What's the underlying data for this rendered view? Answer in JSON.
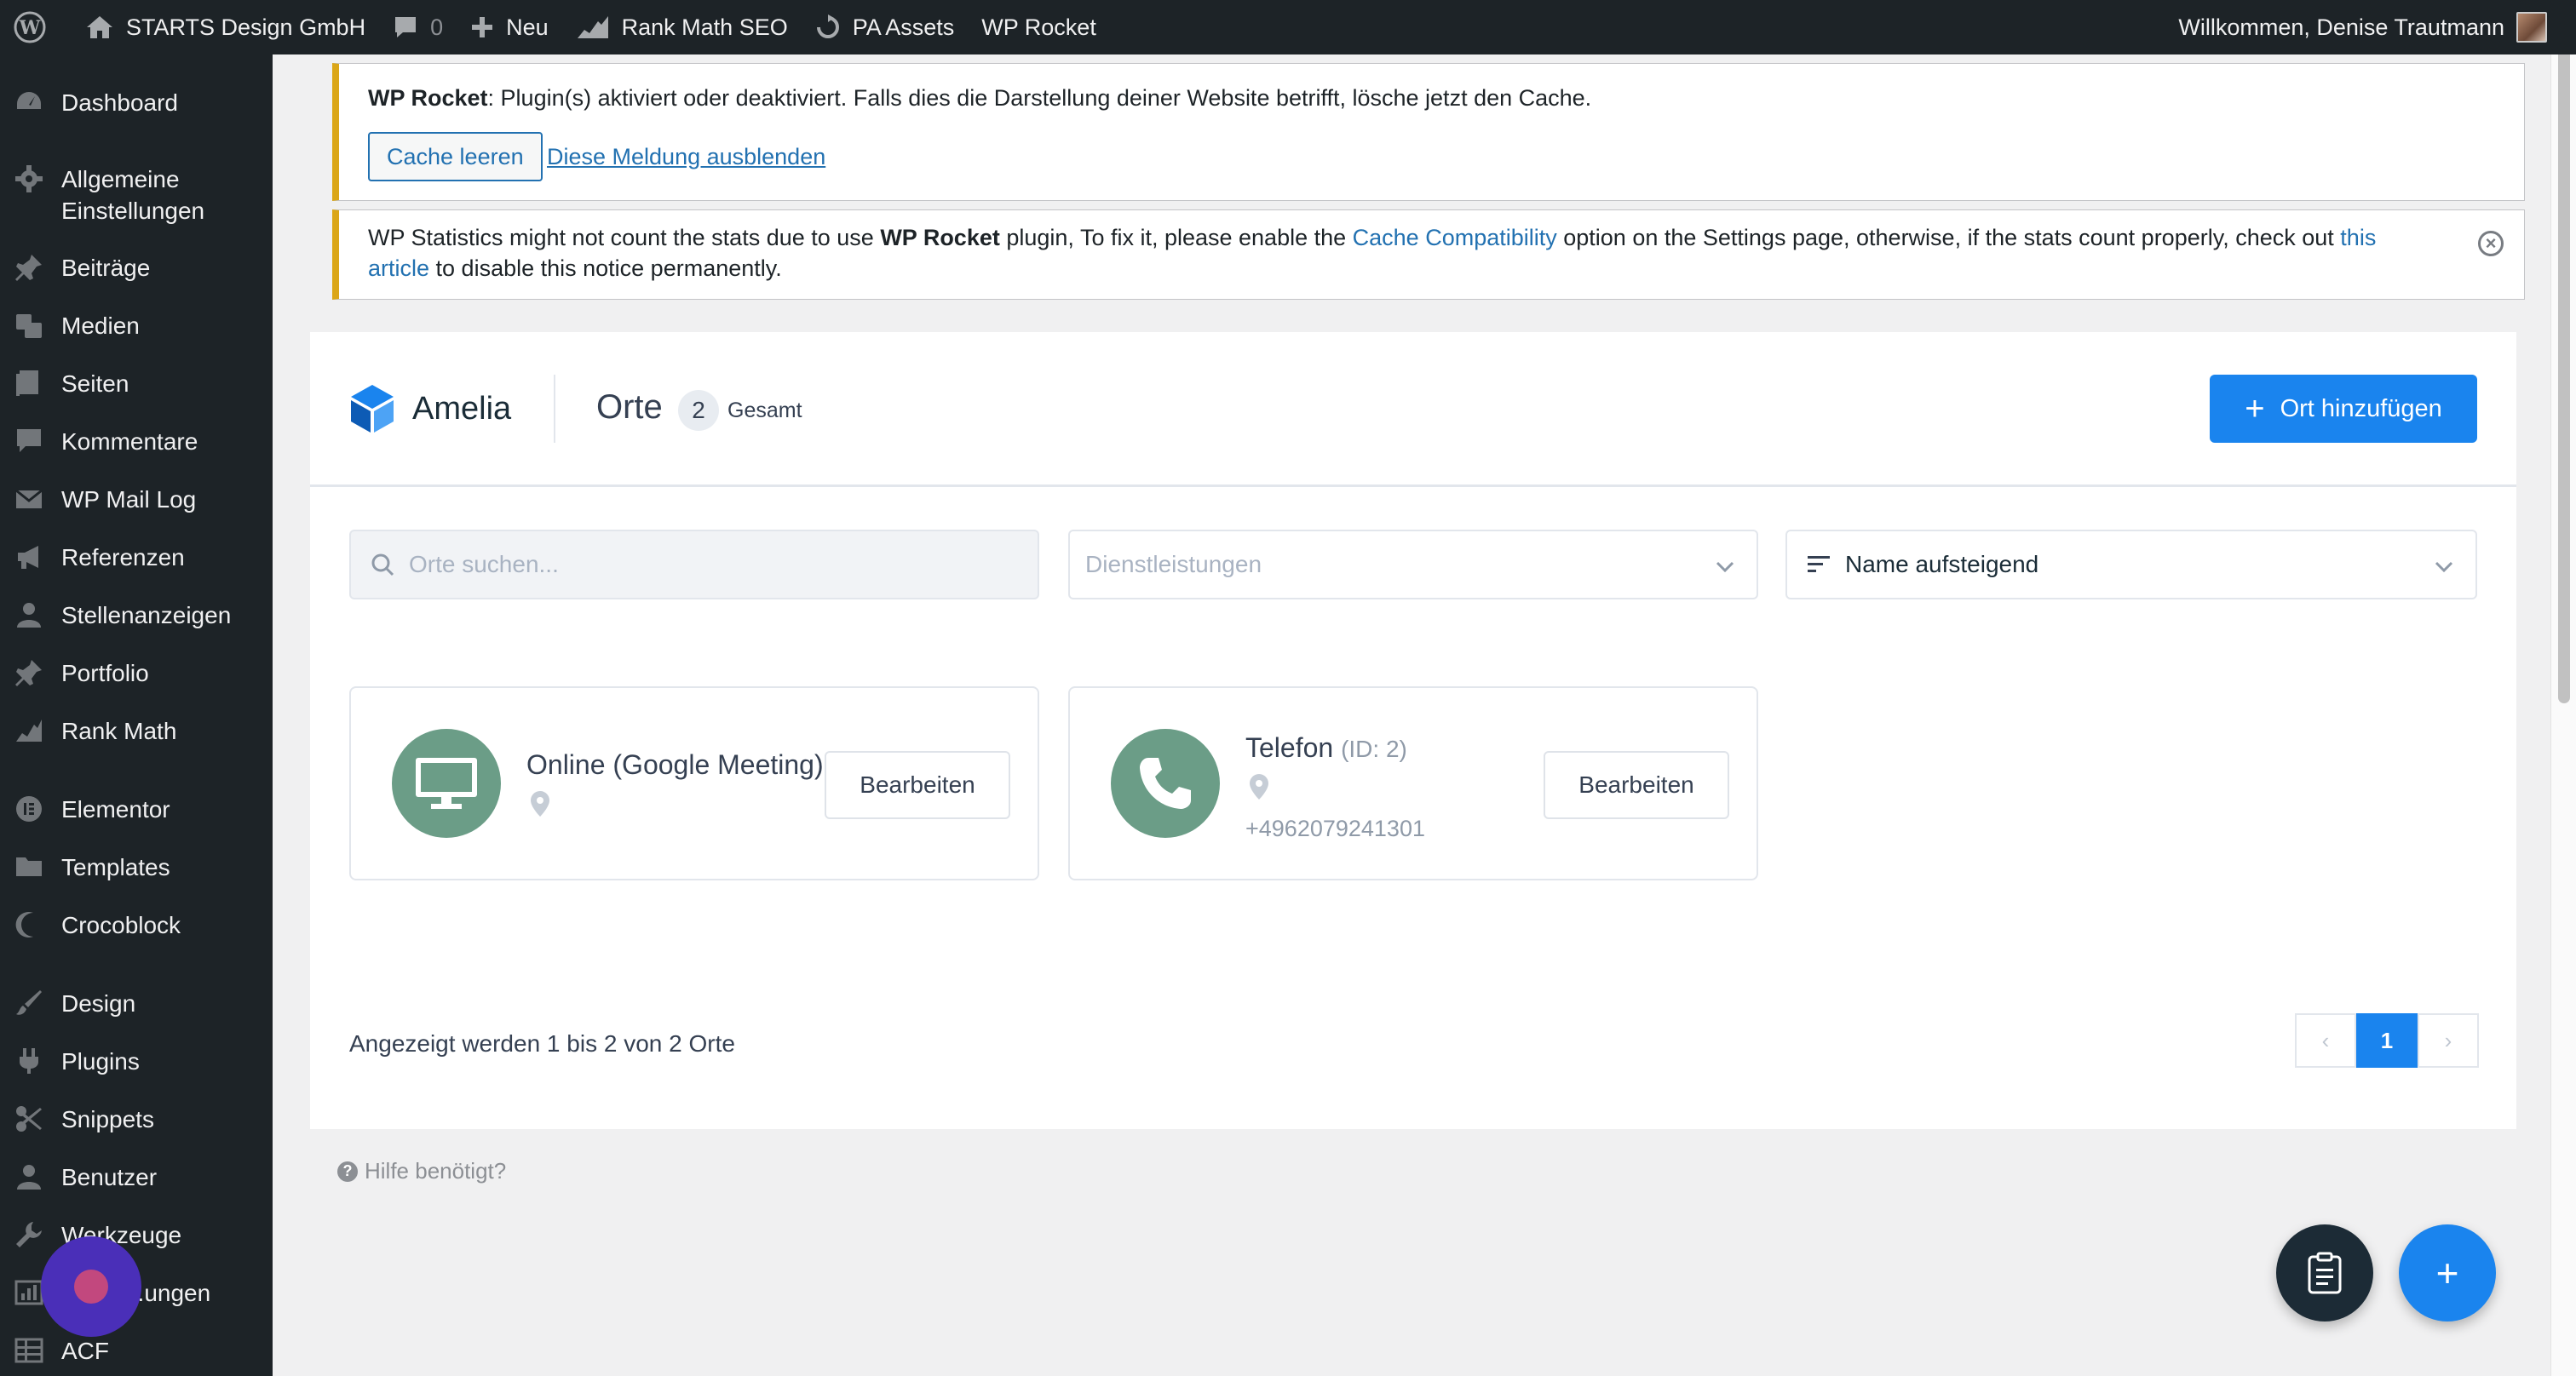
{
  "admin_bar": {
    "site_name": "STARTS Design GmbH",
    "comments_count": "0",
    "new_label": "Neu",
    "rank_math": "Rank Math SEO",
    "pa_assets": "PA Assets",
    "wp_rocket": "WP Rocket",
    "welcome": "Willkommen, Denise Trautmann"
  },
  "sidebar": {
    "items": [
      {
        "label": "Dashboard",
        "icon": "dashboard-icon"
      },
      {
        "label": "Allgemeine Einstellungen",
        "icon": "gear-icon"
      },
      {
        "label": "Beiträge",
        "icon": "pin-icon"
      },
      {
        "label": "Medien",
        "icon": "media-icon"
      },
      {
        "label": "Seiten",
        "icon": "pages-icon"
      },
      {
        "label": "Kommentare",
        "icon": "comment-icon"
      },
      {
        "label": "WP Mail Log",
        "icon": "mail-icon"
      },
      {
        "label": "Referenzen",
        "icon": "megaphone-icon"
      },
      {
        "label": "Stellenanzeigen",
        "icon": "user-icon"
      },
      {
        "label": "Portfolio",
        "icon": "pin-icon"
      },
      {
        "label": "Rank Math",
        "icon": "chart-icon"
      },
      {
        "label": "Elementor",
        "icon": "elementor-icon"
      },
      {
        "label": "Templates",
        "icon": "folder-icon"
      },
      {
        "label": "Crocoblock",
        "icon": "crocoblock-icon"
      },
      {
        "label": "Design",
        "icon": "brush-icon"
      },
      {
        "label": "Plugins",
        "icon": "plug-icon"
      },
      {
        "label": "Snippets",
        "icon": "scissors-icon"
      },
      {
        "label": "Benutzer",
        "icon": "user-icon"
      },
      {
        "label": "Werkzeuge",
        "icon": "wrench-icon"
      },
      {
        "label": "...ungen",
        "icon": "settings-icon"
      },
      {
        "label": "ACF",
        "icon": "table-icon"
      }
    ]
  },
  "notices": {
    "rocket": {
      "strong": "WP Rocket",
      "text": ": Plugin(s) aktiviert oder deaktiviert. Falls dies die Darstellung deiner Website betrifft, lösche jetzt den Cache.",
      "clear_button": "Cache leeren",
      "dismiss_link": "Diese Meldung ausblenden"
    },
    "stats": {
      "part1": "WP Statistics might not count the stats due to use ",
      "strong": "WP Rocket",
      "part2": " plugin, To fix it, please enable the ",
      "link1": "Cache Compatibility",
      "part3": " option on the Settings page, otherwise, if the stats count properly, check out ",
      "link2a": "this",
      "link2b": "article",
      "part4": " to disable this notice permanently."
    }
  },
  "amelia": {
    "brand": "Amelia",
    "title": "Orte",
    "count": "2",
    "count_label": "Gesamt",
    "add_button": "Ort hinzufügen",
    "search_placeholder": "Orte suchen...",
    "services_placeholder": "Dienstleistungen",
    "sort_value": "Name aufsteigend",
    "locations": [
      {
        "name": "Online (Google Meeting)",
        "id": "",
        "phone": "",
        "edit": "Bearbeiten"
      },
      {
        "name": "Telefon",
        "id": "(ID: 2)",
        "phone": "+4962079241301",
        "edit": "Bearbeiten"
      }
    ],
    "footer_text": "Angezeigt werden 1 bis 2 von 2 Orte",
    "current_page": "1",
    "help": "Hilfe benötigt?"
  },
  "colors": {
    "admin_dark": "#1d2327",
    "accent_blue": "#1a84ee",
    "notice_yellow": "#dba617",
    "location_green": "#6b9d87"
  }
}
